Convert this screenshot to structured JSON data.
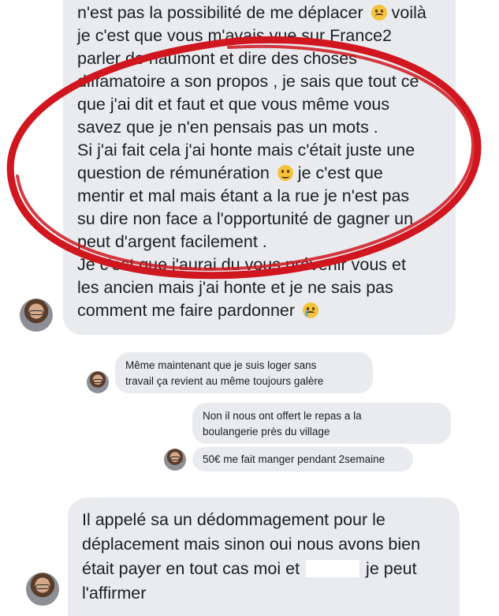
{
  "messages": {
    "large_top": {
      "lines": [
        "n'est pas la possibilité de me déplacer",
        "je c'est que vous m'avais vue sur France2",
        "parler de riaumont et dire des choses",
        "diffamatoire a son propos , je sais que tout ce",
        "que j'ai dit et faut et que vous même vous",
        "savez que je n'en pensais pas un mots .",
        "Si j'ai fait cela j'ai honte mais c'était juste une",
        "question de rémunération",
        "mentir et mal mais étant a la rue je n'est pas",
        "su dire non face a l'opportunité de gagner un",
        "peut d'argent facilement .",
        "Je c'est que j'aurai du vous prévenir vous et",
        "les ancien mais j'ai honte et je ne sais pas",
        "comment me faire pardonner"
      ],
      "line0_suffix": "voilà",
      "line7_suffix": "je c'est que",
      "emoji_1": "confused-face-emoji",
      "emoji_2": "sad-face-emoji",
      "emoji_3": "crying-face-emoji"
    },
    "small_left": {
      "lines": [
        "Même maintenant que je suis loger sans",
        "travail ça revient au même toujours galère"
      ]
    },
    "small_right_1": {
      "lines": [
        "Non il nous ont offert le repas a la",
        "boulangerie près du village"
      ]
    },
    "small_right_2": {
      "lines": [
        "50€ me fait manger pendant 2semaine"
      ]
    },
    "large_bottom": {
      "lines": [
        "Il appelé sa un dédommagement pour le",
        "déplacement mais sinon oui nous avons bien",
        "était payer en tout cas moi et",
        "je peut",
        "l'affirmer"
      ]
    }
  },
  "colors": {
    "bubble_bg": "#e9ebee",
    "text": "#1c1e21",
    "annotation_ellipse": "#d0161f"
  }
}
